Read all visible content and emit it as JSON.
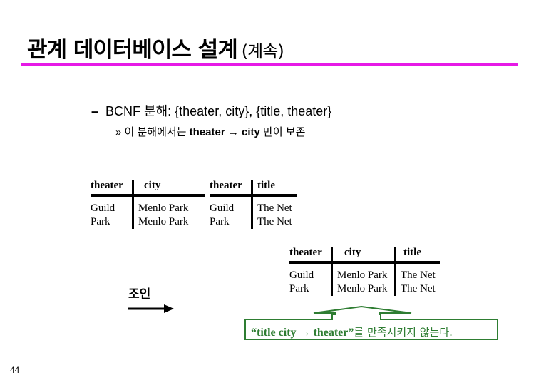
{
  "slide": {
    "title": "관계 데이터베이스 설계",
    "title_suffix": "(계속)",
    "accent_color": "#e619e6",
    "page_number": "44"
  },
  "bullets": {
    "level1": {
      "marker": "–",
      "text": "BCNF 분해: {theater, city}, {title, theater}"
    },
    "level2": {
      "marker": "»",
      "prefix": "이 분해에서는 ",
      "dependency": "theater → city",
      "suffix": " 만이 보존"
    }
  },
  "relation1": {
    "headers": [
      "theater",
      "city"
    ],
    "rows": [
      [
        "Guild",
        "Menlo Park"
      ],
      [
        "Park",
        "Menlo Park"
      ]
    ]
  },
  "relation2": {
    "headers": [
      "theater",
      "title"
    ],
    "rows": [
      [
        "Guild",
        "The Net"
      ],
      [
        "Park",
        "The Net"
      ]
    ]
  },
  "joined": {
    "label": "조인",
    "headers": [
      "theater",
      "city",
      "title"
    ],
    "rows": [
      [
        "Guild",
        "Menlo Park",
        "The Net"
      ],
      [
        "Park",
        "Menlo Park",
        "The Net"
      ]
    ]
  },
  "callout": {
    "quoted": "“title city → theater”",
    "korean": "를 만족시키지 않는다.",
    "color": "#2e7d32"
  }
}
